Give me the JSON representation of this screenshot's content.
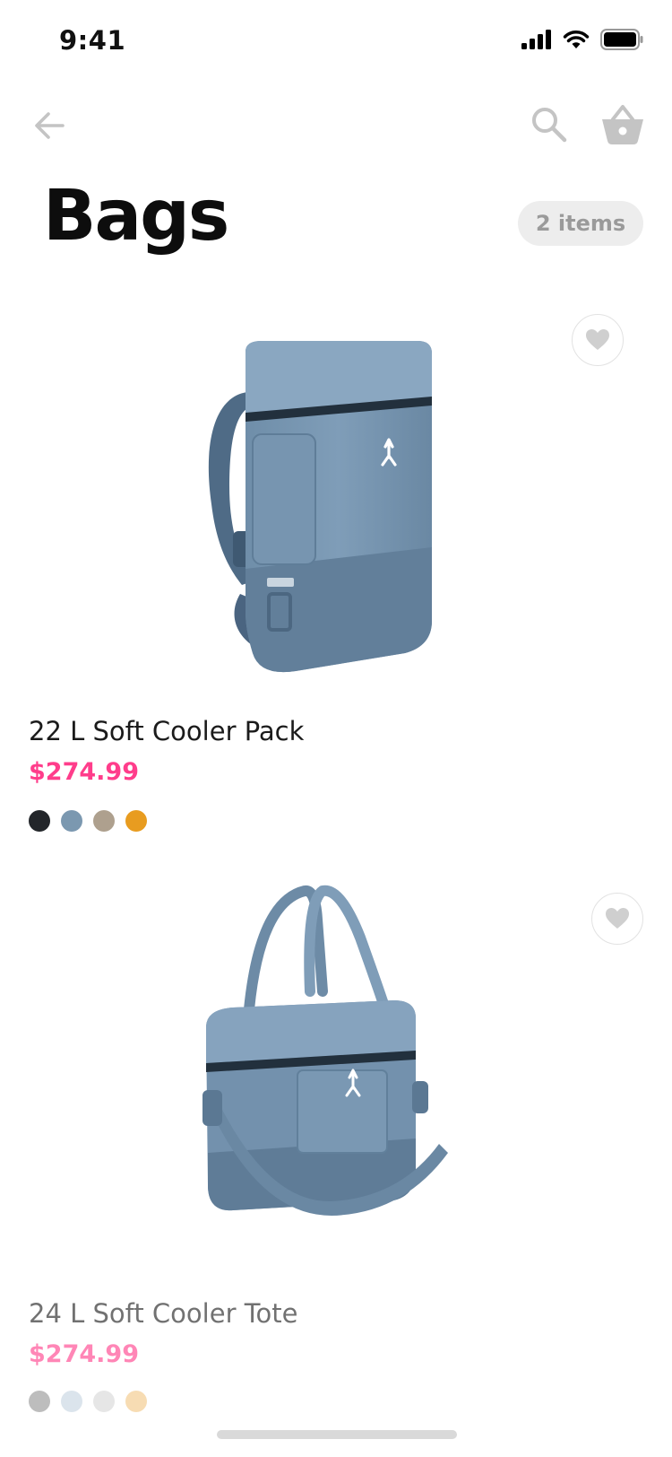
{
  "status_bar": {
    "time": "9:41"
  },
  "nav": {
    "back_icon": "arrow-left-icon",
    "search_icon": "search-icon",
    "cart_icon": "shopping-basket-icon",
    "icon_color": "#c4c4c4"
  },
  "header": {
    "title": "Bags",
    "count_badge": "2 items"
  },
  "accent_color": "#ff3d8b",
  "products": [
    {
      "name": "22 L Soft Cooler Pack",
      "price": "$274.99",
      "image": "cooler-backpack",
      "favorite_icon": "heart-icon",
      "swatches": [
        "#23262a",
        "#7b98b0",
        "#aea08e",
        "#e89c20"
      ]
    },
    {
      "name": "24 L Soft Cooler Tote",
      "price": "$274.99",
      "image": "cooler-tote",
      "favorite_icon": "heart-icon",
      "swatches": [
        "#bdbdbd",
        "#dbe4ec",
        "#e6e6e6",
        "#f7dcb3"
      ]
    }
  ]
}
